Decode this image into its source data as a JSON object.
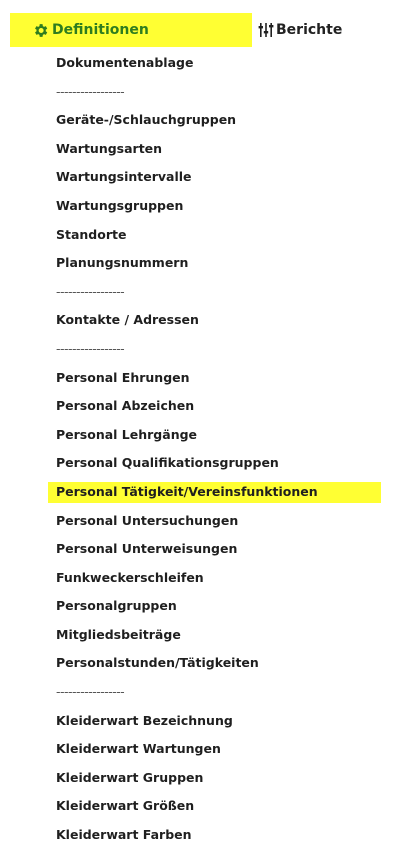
{
  "tabs": {
    "definitionen": {
      "label": "Definitionen",
      "icon": "gear-icon",
      "active": true
    },
    "berichte": {
      "label": "Berichte",
      "icon": "sliders-icon"
    }
  },
  "colors": {
    "highlight": "#ffff33",
    "active_tab_text": "#2f7d1f",
    "text": "#1f1f1f"
  },
  "menu": {
    "items": [
      {
        "label": "Dokumentenablage",
        "type": "item"
      },
      {
        "label": "-----------------",
        "type": "separator"
      },
      {
        "label": "Geräte-/Schlauchgruppen",
        "type": "item"
      },
      {
        "label": "Wartungsarten",
        "type": "item"
      },
      {
        "label": "Wartungsintervalle",
        "type": "item"
      },
      {
        "label": "Wartungsgruppen",
        "type": "item"
      },
      {
        "label": "Standorte",
        "type": "item"
      },
      {
        "label": "Planungsnummern",
        "type": "item"
      },
      {
        "label": "-----------------",
        "type": "separator"
      },
      {
        "label": "Kontakte / Adressen",
        "type": "item"
      },
      {
        "label": "-----------------",
        "type": "separator"
      },
      {
        "label": "Personal Ehrungen",
        "type": "item"
      },
      {
        "label": "Personal Abzeichen",
        "type": "item"
      },
      {
        "label": "Personal Lehrgänge",
        "type": "item"
      },
      {
        "label": "Personal Qualifikationsgruppen",
        "type": "item"
      },
      {
        "label": "Personal Tätigkeit/Vereinsfunktionen",
        "type": "item",
        "highlighted": true
      },
      {
        "label": "Personal Untersuchungen",
        "type": "item"
      },
      {
        "label": "Personal Unterweisungen",
        "type": "item"
      },
      {
        "label": "Funkweckerschleifen",
        "type": "item"
      },
      {
        "label": "Personalgruppen",
        "type": "item"
      },
      {
        "label": "Mitgliedsbeiträge",
        "type": "item"
      },
      {
        "label": "Personalstunden/Tätigkeiten",
        "type": "item"
      },
      {
        "label": "-----------------",
        "type": "separator"
      },
      {
        "label": "Kleiderwart Bezeichnung",
        "type": "item"
      },
      {
        "label": "Kleiderwart Wartungen",
        "type": "item"
      },
      {
        "label": "Kleiderwart Gruppen",
        "type": "item"
      },
      {
        "label": "Kleiderwart Größen",
        "type": "item"
      },
      {
        "label": "Kleiderwart Farben",
        "type": "item"
      }
    ]
  }
}
